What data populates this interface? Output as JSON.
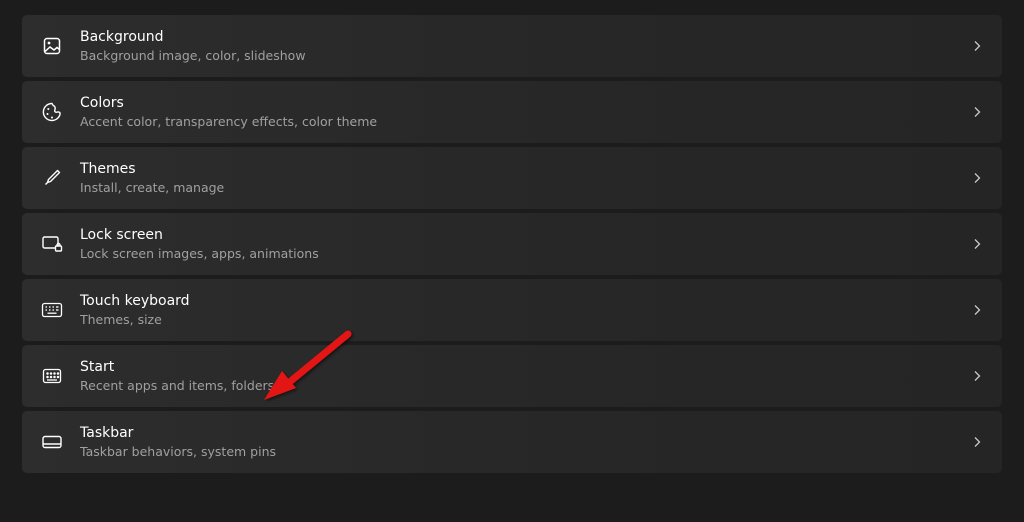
{
  "items": [
    {
      "title": "Background",
      "subtitle": "Background image, color, slideshow"
    },
    {
      "title": "Colors",
      "subtitle": "Accent color, transparency effects, color theme"
    },
    {
      "title": "Themes",
      "subtitle": "Install, create, manage"
    },
    {
      "title": "Lock screen",
      "subtitle": "Lock screen images, apps, animations"
    },
    {
      "title": "Touch keyboard",
      "subtitle": "Themes, size"
    },
    {
      "title": "Start",
      "subtitle": "Recent apps and items, folders"
    },
    {
      "title": "Taskbar",
      "subtitle": "Taskbar behaviors, system pins"
    }
  ]
}
